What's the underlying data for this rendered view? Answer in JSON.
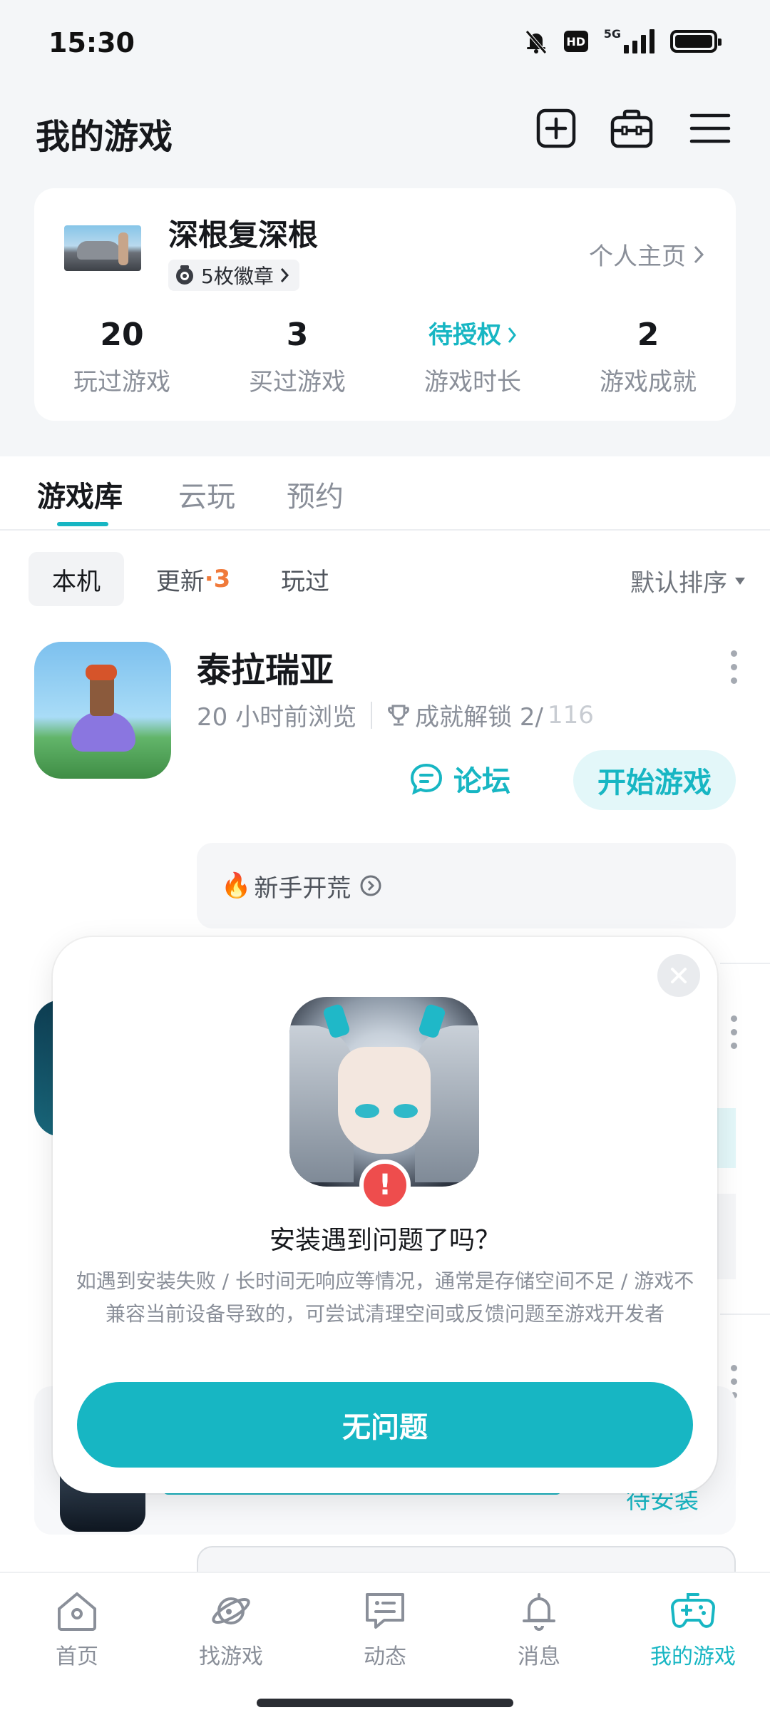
{
  "status_bar": {
    "time": "15:30",
    "hd": "HD",
    "network": "5G"
  },
  "header": {
    "title": "我的游戏"
  },
  "profile": {
    "username": "深根复深根",
    "badges": "5枚徽章",
    "homepage_link": "个人主页",
    "stats": [
      {
        "value": "20",
        "label": "玩过游戏"
      },
      {
        "value": "3",
        "label": "买过游戏"
      },
      {
        "value": "待授权",
        "label": "游戏时长"
      },
      {
        "value": "2",
        "label": "游戏成就"
      }
    ]
  },
  "tabs": [
    {
      "label": "游戏库",
      "active": true
    },
    {
      "label": "云玩",
      "active": false
    },
    {
      "label": "预约",
      "active": false
    }
  ],
  "filters": {
    "local": "本机",
    "update": "更新",
    "update_count": "·3",
    "played": "玩过",
    "sort": "默认排序"
  },
  "game": {
    "name": "泰拉瑞亚",
    "last_browsed": "20 小时前浏览",
    "achievement_label": "成就解锁 2/",
    "achievement_total": "116",
    "forum_label": "论坛",
    "start_label": "开始游戏",
    "tip": "新手开荒"
  },
  "background_card": {
    "install_label": "待安装"
  },
  "modal": {
    "title": "安装遇到问题了吗？",
    "description": "如遇到安装失败 / 长时间无响应等情况，通常是存储空间不足 / 游戏不兼容当前设备导致的，可尝试清理空间或反馈问题至游戏开发者",
    "confirm_label": "无问题",
    "warning_symbol": "!"
  },
  "bottom_nav": [
    {
      "label": "首页",
      "icon": "home-icon",
      "active": false
    },
    {
      "label": "找游戏",
      "icon": "planet-icon",
      "active": false
    },
    {
      "label": "动态",
      "icon": "chat-icon",
      "active": false
    },
    {
      "label": "消息",
      "icon": "bell-icon",
      "active": false
    },
    {
      "label": "我的游戏",
      "icon": "gamepad-icon",
      "active": true
    }
  ],
  "colors": {
    "accent": "#17b6c3",
    "warning": "#ee4d4d",
    "update_dot": "#f07a3a"
  }
}
